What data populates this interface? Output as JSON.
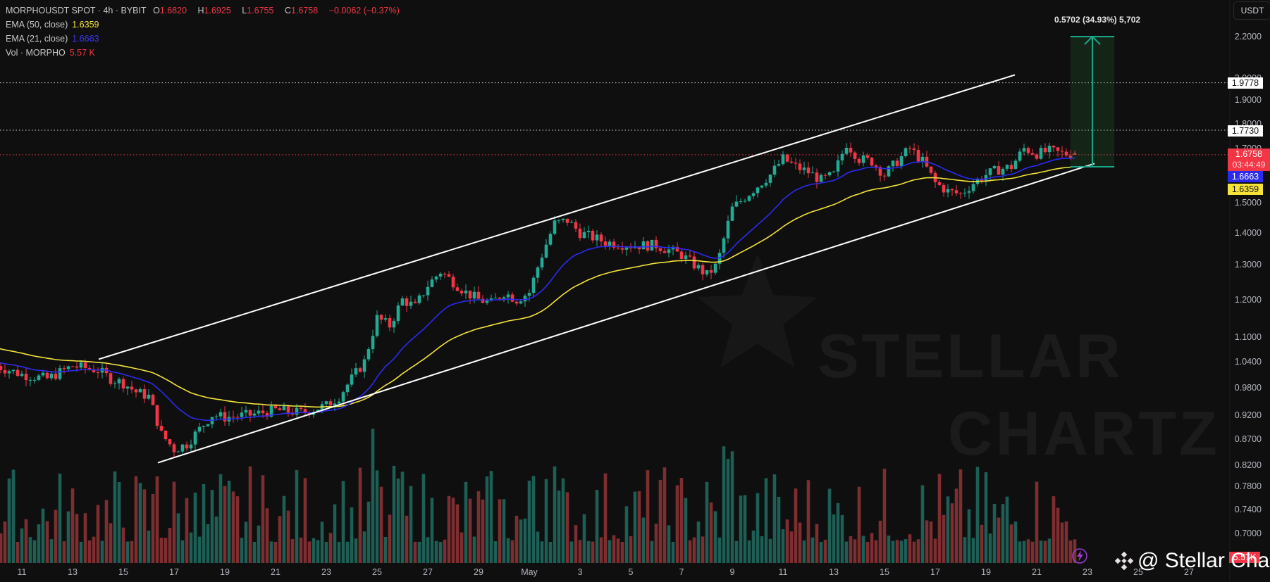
{
  "legend": {
    "symbol": "MORPHOUSDT SPOT · 4h · BYBIT",
    "o_label": "O",
    "o": "1.6820",
    "h_label": "H",
    "h": "1.6925",
    "l_label": "L",
    "l": "1.6755",
    "c_label": "C",
    "c": "1.6758",
    "change": "−0.0062 (−0.37%)",
    "ema50_label": "EMA (50, close)",
    "ema50": "1.6359",
    "ema21_label": "EMA (21, close)",
    "ema21": "1.6663",
    "vol_label": "Vol · MORPHO",
    "vol": "5.57 K"
  },
  "currency_button": "USDT",
  "measure_label": "0.5702 (34.93%) 5,702",
  "badges": {
    "level_high": "1.9778",
    "level_mid": "1.7730",
    "last_price": "1.6758",
    "countdown": "03:44:49",
    "ema21": "1.6663",
    "ema50": "1.6359",
    "volume": "5.57K"
  },
  "watermark": {
    "line1": "STELLAR",
    "line2": "CHARTZ"
  },
  "brand": "@ Stellar Chartz",
  "colors": {
    "up": "#22ab94",
    "down": "#f23645",
    "ema21": "#2b2bf0",
    "ema50": "#f5e33a",
    "vol_up": "#1d5e55",
    "vol_down": "#7e2e30",
    "measure": "#1aa68a"
  },
  "chart_data": {
    "type": "candlestick",
    "title": "MORPHOUSDT SPOT · 4h · BYBIT",
    "scale": "log",
    "ylim": [
      0.7,
      2.2
    ],
    "x_unit": "days from May 1",
    "y_ticks": [
      "2.2000",
      "2.0000",
      "1.9000",
      "1.8000",
      "1.7000",
      "1.5000",
      "1.4000",
      "1.3000",
      "1.2000",
      "1.1000",
      "1.0400",
      "0.9800",
      "0.9200",
      "0.8700",
      "0.8200",
      "0.7800",
      "0.7400",
      "0.7000"
    ],
    "x_ticks": [
      {
        "label": "11",
        "day": -20
      },
      {
        "label": "13",
        "day": -18
      },
      {
        "label": "15",
        "day": -16
      },
      {
        "label": "17",
        "day": -14
      },
      {
        "label": "19",
        "day": -12
      },
      {
        "label": "21",
        "day": -10
      },
      {
        "label": "23",
        "day": -8
      },
      {
        "label": "25",
        "day": -6
      },
      {
        "label": "27",
        "day": -4
      },
      {
        "label": "29",
        "day": -2
      },
      {
        "label": "May",
        "day": 0
      },
      {
        "label": "3",
        "day": 2
      },
      {
        "label": "5",
        "day": 4
      },
      {
        "label": "7",
        "day": 6
      },
      {
        "label": "9",
        "day": 8
      },
      {
        "label": "11",
        "day": 10
      },
      {
        "label": "13",
        "day": 12
      },
      {
        "label": "15",
        "day": 14
      },
      {
        "label": "17",
        "day": 16
      },
      {
        "label": "19",
        "day": 18
      },
      {
        "label": "21",
        "day": 20
      },
      {
        "label": "23",
        "day": 22
      },
      {
        "label": "25",
        "day": 24
      },
      {
        "label": "27",
        "day": 26
      }
    ],
    "price_path": [
      [
        -21,
        1.03
      ],
      [
        -20,
        1.01
      ],
      [
        -19,
        1.0
      ],
      [
        -18,
        1.03
      ],
      [
        -17,
        1.02
      ],
      [
        -16.5,
        1.0
      ],
      [
        -16,
        0.99
      ],
      [
        -15.5,
        0.97
      ],
      [
        -15,
        0.96
      ],
      [
        -14.5,
        0.88
      ],
      [
        -14,
        0.85
      ],
      [
        -13.5,
        0.86
      ],
      [
        -13,
        0.89
      ],
      [
        -12.5,
        0.92
      ],
      [
        -12,
        0.915
      ],
      [
        -11,
        0.92
      ],
      [
        -10,
        0.93
      ],
      [
        -9,
        0.925
      ],
      [
        -8,
        0.94
      ],
      [
        -7.5,
        0.96
      ],
      [
        -7,
        1.0
      ],
      [
        -6.5,
        1.04
      ],
      [
        -6,
        1.15
      ],
      [
        -5.5,
        1.13
      ],
      [
        -5,
        1.2
      ],
      [
        -4.5,
        1.18
      ],
      [
        -4,
        1.24
      ],
      [
        -3.5,
        1.28
      ],
      [
        -3,
        1.25
      ],
      [
        -2.5,
        1.22
      ],
      [
        -2,
        1.2
      ],
      [
        -1.5,
        1.19
      ],
      [
        -1,
        1.22
      ],
      [
        -0.5,
        1.2
      ],
      [
        0,
        1.22
      ],
      [
        0.5,
        1.33
      ],
      [
        1,
        1.43
      ],
      [
        1.5,
        1.44
      ],
      [
        2,
        1.4
      ],
      [
        3,
        1.37
      ],
      [
        4,
        1.36
      ],
      [
        5,
        1.36
      ],
      [
        6,
        1.33
      ],
      [
        7,
        1.27
      ],
      [
        7.4,
        1.3
      ],
      [
        8,
        1.48
      ],
      [
        8.5,
        1.52
      ],
      [
        9,
        1.56
      ],
      [
        9.5,
        1.6
      ],
      [
        10,
        1.66
      ],
      [
        10.5,
        1.63
      ],
      [
        11,
        1.61
      ],
      [
        11.5,
        1.58
      ],
      [
        12,
        1.6
      ],
      [
        12.5,
        1.72
      ],
      [
        13,
        1.66
      ],
      [
        13.5,
        1.65
      ],
      [
        14,
        1.6
      ],
      [
        14.5,
        1.65
      ],
      [
        15,
        1.7
      ],
      [
        15.5,
        1.65
      ],
      [
        16,
        1.57
      ],
      [
        16.5,
        1.54
      ],
      [
        17,
        1.53
      ],
      [
        17.5,
        1.57
      ],
      [
        18,
        1.6
      ],
      [
        18.5,
        1.62
      ],
      [
        19,
        1.63
      ],
      [
        19.5,
        1.7
      ],
      [
        20,
        1.68
      ],
      [
        20.5,
        1.69
      ],
      [
        21,
        1.68
      ],
      [
        21.5,
        1.6758
      ]
    ],
    "last_candle": {
      "open": 1.682,
      "high": 1.6925,
      "low": 1.6755,
      "close": 1.6758
    },
    "ema_periods": [
      21,
      50
    ],
    "horizontal_levels": [
      1.9778,
      1.773,
      1.6758
    ],
    "channel": {
      "upper": [
        [
          -16.97,
          1.046
        ],
        [
          19.14,
          2.014
        ]
      ],
      "lower": [
        [
          -14.64,
          0.824
        ],
        [
          22.28,
          1.642
        ]
      ]
    },
    "measurement": {
      "from_day": 21.33,
      "to_day": 23.06,
      "from_price": 1.6298,
      "to_price": 2.2,
      "change": 0.5702,
      "percent": 34.93
    },
    "volume_last": "5.57K"
  }
}
